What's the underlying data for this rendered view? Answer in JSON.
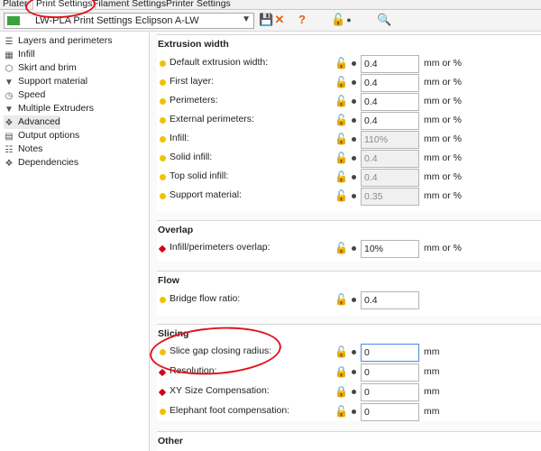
{
  "tabs": [
    "Plater",
    "Print Settings",
    "Filament Settings",
    "Printer Settings"
  ],
  "preset": {
    "name": "LW-PLA Print Settings Eclipson A-LW"
  },
  "sidebar": {
    "items": [
      {
        "label": "Layers and perimeters",
        "icon": "layers-icon"
      },
      {
        "label": "Infill",
        "icon": "infill-icon"
      },
      {
        "label": "Skirt and brim",
        "icon": "skirt-icon"
      },
      {
        "label": "Support material",
        "icon": "support-icon"
      },
      {
        "label": "Speed",
        "icon": "speed-icon"
      },
      {
        "label": "Multiple Extruders",
        "icon": "extruders-icon"
      },
      {
        "label": "Advanced",
        "icon": "advanced-icon"
      },
      {
        "label": "Output options",
        "icon": "output-icon"
      },
      {
        "label": "Notes",
        "icon": "notes-icon"
      },
      {
        "label": "Dependencies",
        "icon": "dependencies-icon"
      }
    ]
  },
  "groups": {
    "extrusion": {
      "title": "Extrusion width",
      "rows": [
        {
          "label": "Default extrusion width:",
          "value": "0.4",
          "unit": "mm or %"
        },
        {
          "label": "First layer:",
          "value": "0.4",
          "unit": "mm or %"
        },
        {
          "label": "Perimeters:",
          "value": "0.4",
          "unit": "mm or %"
        },
        {
          "label": "External perimeters:",
          "value": "0.4",
          "unit": "mm or %"
        },
        {
          "label": "Infill:",
          "value": "110%",
          "unit": "mm or %"
        },
        {
          "label": "Solid infill:",
          "value": "0.4",
          "unit": "mm or %"
        },
        {
          "label": "Top solid infill:",
          "value": "0.4",
          "unit": "mm or %"
        },
        {
          "label": "Support material:",
          "value": "0.35",
          "unit": "mm or %"
        }
      ]
    },
    "overlap": {
      "title": "Overlap",
      "rows": [
        {
          "label": "Infill/perimeters overlap:",
          "value": "10%",
          "unit": "mm or %"
        }
      ]
    },
    "flow": {
      "title": "Flow",
      "rows": [
        {
          "label": "Bridge flow ratio:",
          "value": "0.4",
          "unit": ""
        }
      ]
    },
    "slicing": {
      "title": "Slicing",
      "rows": [
        {
          "label": "Slice gap closing radius:",
          "value": "0",
          "unit": "mm"
        },
        {
          "label": "Resolution:",
          "value": "0",
          "unit": "mm"
        },
        {
          "label": "XY Size Compensation:",
          "value": "0",
          "unit": "mm"
        },
        {
          "label": "Elephant foot compensation:",
          "value": "0",
          "unit": "mm"
        }
      ]
    },
    "other": {
      "title": "Other"
    }
  },
  "colors": {
    "mode_simple": "#f2c200",
    "mode_expert": "#d4001a",
    "unlock": "#e0621a",
    "annotation": "#e0131b"
  }
}
